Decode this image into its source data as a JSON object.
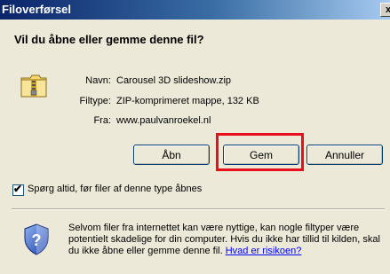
{
  "dialog": {
    "title": "Filoverførsel",
    "close_glyph": "x",
    "heading": "Vil du åbne eller gemme denne fil?",
    "file_icon": "zip-folder-icon",
    "fields": [
      {
        "label": "Navn:",
        "value": "Carousel 3D slideshow.zip"
      },
      {
        "label": "Filtype:",
        "value": "ZIP-komprimeret mappe, 132 KB"
      },
      {
        "label": "Fra:",
        "value": "www.paulvanroekel.nl"
      }
    ],
    "buttons": {
      "open": "Åbn",
      "save": "Gem",
      "cancel": "Annuller"
    },
    "checkbox": {
      "label": "Spørg altid, før filer af denne type åbnes",
      "checked": true
    },
    "warning": {
      "icon": "shield-question-icon",
      "text": "Selvom filer fra internettet kan være nyttige, kan nogle filtyper være potentielt skadelige for din computer. Hvis du ikke har tillid til kilden, skal du ikke åbne eller gemme denne fil.",
      "link": "Hvad er risikoen?"
    },
    "highlight_color": "#e8101a"
  }
}
